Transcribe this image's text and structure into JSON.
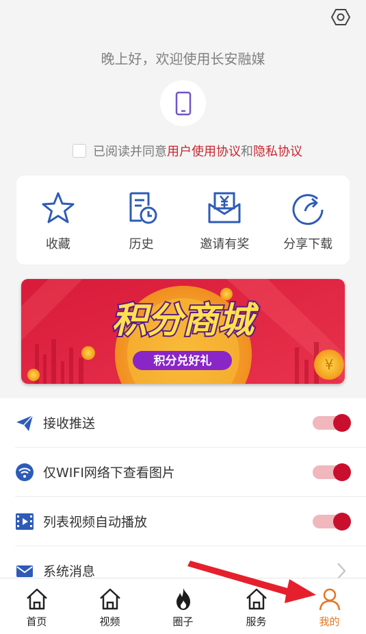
{
  "header": {
    "greeting": "晚上好，欢迎使用长安融媒"
  },
  "login": {
    "agreement_prefix": "已阅读并同意",
    "user_agreement": "用户使用协议",
    "and": "和",
    "privacy_policy": "隐私协议"
  },
  "quick_actions": [
    {
      "label": "收藏",
      "icon": "star-icon"
    },
    {
      "label": "历史",
      "icon": "history-icon"
    },
    {
      "label": "邀请有奖",
      "icon": "invite-reward-icon"
    },
    {
      "label": "分享下载",
      "icon": "share-download-icon"
    }
  ],
  "banner": {
    "title": "积分商城",
    "subtitle": "积分兑好礼"
  },
  "settings": [
    {
      "label": "接收推送",
      "icon": "paper-plane-icon",
      "control": "toggle",
      "on": true
    },
    {
      "label": "仅WIFI网络下查看图片",
      "icon": "wifi-icon",
      "control": "toggle",
      "on": true
    },
    {
      "label": "列表视频自动播放",
      "icon": "video-icon",
      "control": "toggle",
      "on": true
    },
    {
      "label": "系统消息",
      "icon": "mail-icon",
      "control": "chevron"
    }
  ],
  "tabbar": [
    {
      "label": "首页",
      "icon": "home-icon",
      "active": false
    },
    {
      "label": "视频",
      "icon": "video-home-icon",
      "active": false
    },
    {
      "label": "圈子",
      "icon": "flame-icon",
      "active": false
    },
    {
      "label": "服务",
      "icon": "service-icon",
      "active": false
    },
    {
      "label": "我的",
      "icon": "user-icon",
      "active": true
    }
  ],
  "colors": {
    "accent_red": "#c8102e",
    "icon_blue": "#2e5bb8",
    "active_orange": "#e8741f",
    "phone_purple": "#6f55c9"
  }
}
